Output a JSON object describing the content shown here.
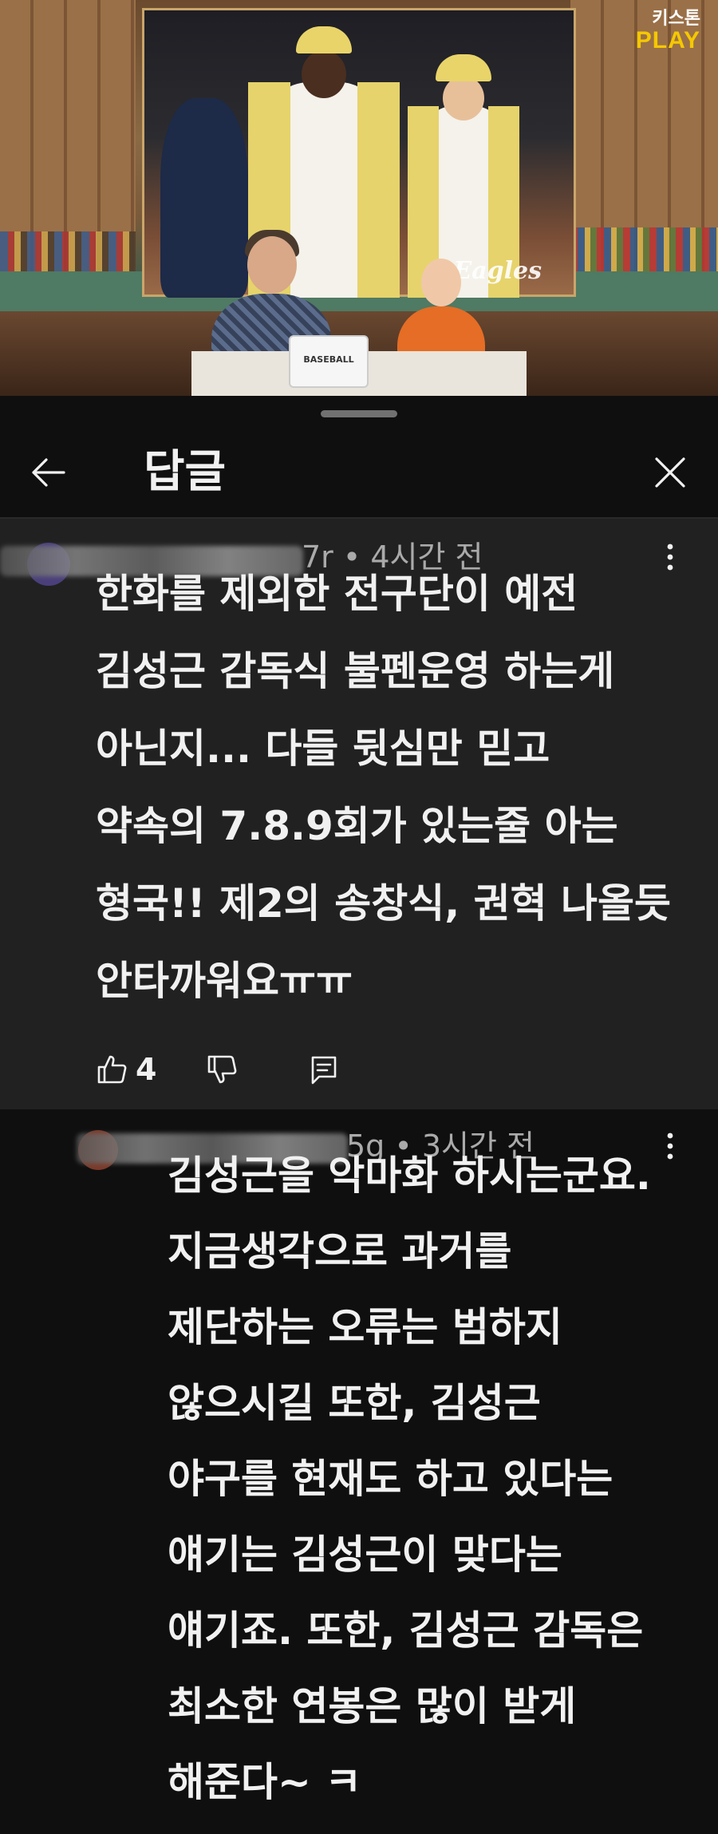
{
  "video": {
    "channel_logo_line1": "키스톤",
    "channel_logo_line2": "PLAY",
    "photo_watermark": "Eagles",
    "laptop_label": "BASEBALL"
  },
  "panel": {
    "title": "답글",
    "back_icon": "arrow-left-icon",
    "close_icon": "close-icon"
  },
  "parent_comment": {
    "meta": "7r • 4시간 전",
    "text": "한화를 제외한 전구단이 예전\n김성근 감독식 불펜운영 하는게\n아닌지... 다들 뒷심만 믿고\n약속의 7.8.9회가 있는줄 아는\n형국!! 제2의 송창식, 권혁 나올듯\n안타까워요ㅠㅠ",
    "like_count": "4",
    "colors": {
      "background": "#212121",
      "meta": "#aaaaaa"
    }
  },
  "reply_comment": {
    "meta": "5g • 3시간 전",
    "text": "김성근을 악마화 하시는군요.\n지금생각으로 과거를\n제단하는 오류는 범하지\n않으시길 또한, 김성근\n야구를 현재도 하고 있다는\n얘기는 김성근이 맞다는\n얘기죠. 또한, 김성근 감독은\n최소한 연봉은 많이 받게\n해준다~ ㅋ"
  }
}
